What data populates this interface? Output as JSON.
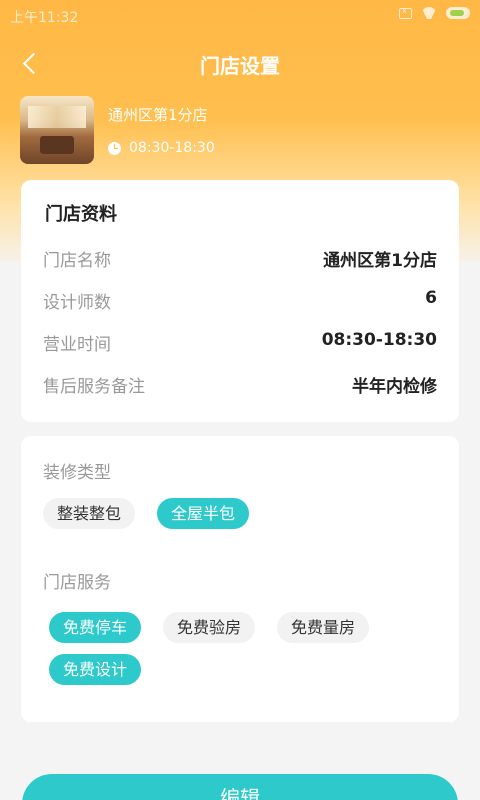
{
  "status_bar": {
    "time": "上午11:32"
  },
  "nav": {
    "title": "门店设置"
  },
  "store": {
    "name": "通州区第1分店",
    "hours": "08:30-18:30"
  },
  "info_card": {
    "title": "门店资料",
    "rows": [
      {
        "label": "门店名称",
        "value": "通州区第1分店"
      },
      {
        "label": "设计师数",
        "value": "6"
      },
      {
        "label": "营业时间",
        "value": "08:30-18:30"
      },
      {
        "label": "售后服务备注",
        "value": "半年内检修"
      }
    ]
  },
  "decoration_type": {
    "label": "装修类型",
    "options": [
      {
        "label": "整装整包",
        "selected": false
      },
      {
        "label": "全屋半包",
        "selected": true
      }
    ]
  },
  "store_services": {
    "label": "门店服务",
    "options": [
      {
        "label": "免费停车",
        "selected": true
      },
      {
        "label": "免费验房",
        "selected": false
      },
      {
        "label": "免费量房",
        "selected": false
      },
      {
        "label": "免费设计",
        "selected": true
      }
    ]
  },
  "actions": {
    "edit_label": "编辑"
  },
  "colors": {
    "header": "#ffb845",
    "accent": "#2ec9cb",
    "tag_bg": "#f2f2f2"
  }
}
